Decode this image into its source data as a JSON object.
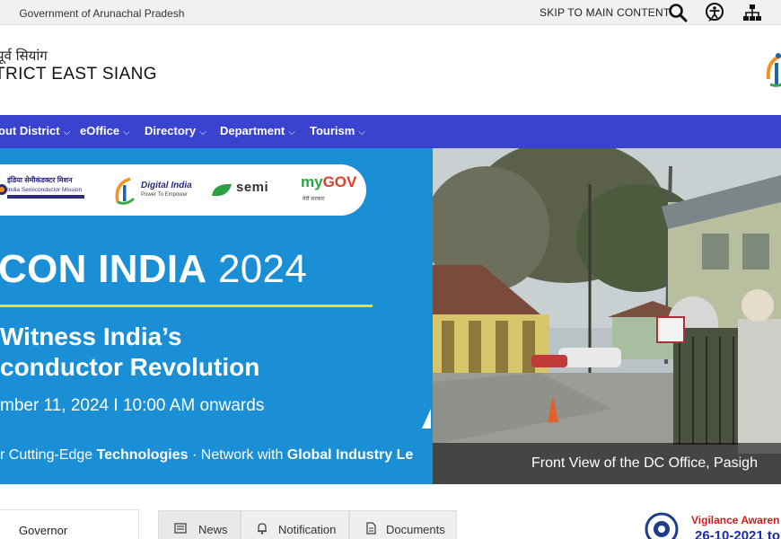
{
  "topbar": {
    "govt_text": "Government of Arunachal Pradesh",
    "skip_label": "SKIP TO MAIN CONTENT",
    "icons": [
      "search-icon",
      "accessibility-icon",
      "sitemap-icon"
    ]
  },
  "header": {
    "district_hindi": "पूर्व सियांग",
    "district_name": "TRICT EAST SIANG",
    "logo": "digital-india-logo"
  },
  "nav": {
    "items": [
      {
        "label": "out District"
      },
      {
        "label": "eOffice"
      },
      {
        "label": "Directory"
      },
      {
        "label": "Department"
      },
      {
        "label": "Tourism"
      }
    ]
  },
  "banner": {
    "logos": {
      "ism_hindi": "इंडिया सेमीकंडक्टर मिशन",
      "ism_english": "India Semiconductor Mission",
      "digital_india": "Digital India",
      "digital_india_sub": "Power To Empower",
      "semi": "semi",
      "mygov_my": "my",
      "mygov_gov": "GOV",
      "mygov_sub": "मेरी सरकार"
    },
    "title_bold": "CON INDIA",
    "title_year": " 2024",
    "line1": "Witness India’s",
    "line2": "conductor Revolution",
    "date": "mber 11, 2024 I 10:00 AM onwards",
    "tag_pre": "r Cutting-Edge ",
    "tag_b1": "Technologies",
    "tag_mid": " · Network with ",
    "tag_b2": "Global Industry Le"
  },
  "hero_photo": {
    "caption": "Front View of the DC Office, Pasigh"
  },
  "governor": {
    "label": "Governor"
  },
  "tabs": [
    {
      "label": "News",
      "icon": "newspaper-icon"
    },
    {
      "label": "Notification",
      "icon": "bell-icon"
    },
    {
      "label": "Documents",
      "icon": "document-icon"
    }
  ],
  "vigilance": {
    "title": "Vigilance Awaren",
    "date": "26-10-2021 to"
  },
  "colors": {
    "nav_bg": "#3a43cf",
    "banner_bg": "#1a8fd6",
    "vigilance_title": "#d11c1c",
    "vigilance_date": "#1a2ab0"
  }
}
